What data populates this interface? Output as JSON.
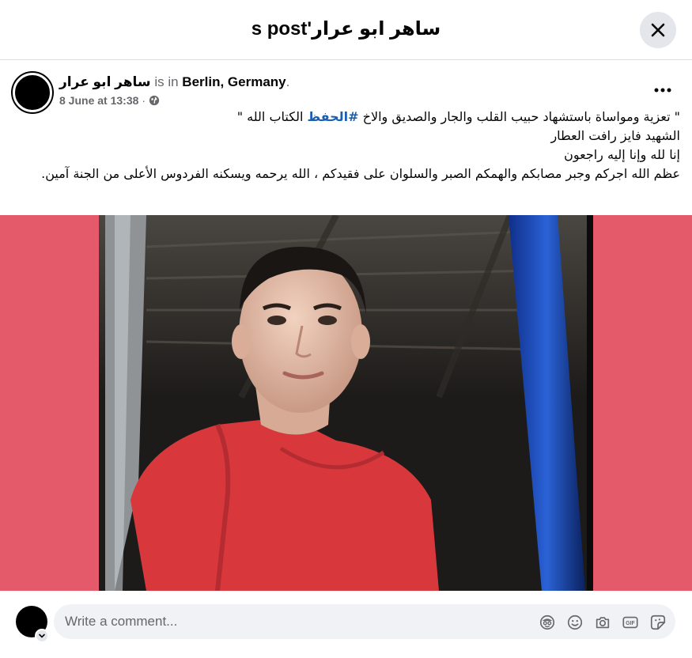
{
  "dialog": {
    "title": "ساهر ابو عرار's post",
    "close_icon": "close-icon"
  },
  "post": {
    "author": "ساهر ابو عرار",
    "is_in": "is in",
    "location": "Berlin, Germany",
    "location_suffix": ".",
    "timestamp": "8 June at 13:38",
    "separator": "·",
    "audience_icon": "globe-icon",
    "more_icon": "more-horizontal-icon",
    "text": {
      "line1_before": "\" تعزية ومواساة باستشهاد حبيب القلب والجار والصديق والاخ ",
      "hashtag": "#الحفظ",
      "line1_after": " الكتاب الله  \"",
      "line2": "الشهيد فايز رافت العطار",
      "line3": "إنا لله وإنا إليه راجعون",
      "line4": "عظم الله اجركم وجبر مصابكم والهمكم الصبر والسلوان على فقيدكم ، الله يرحمه ويسكنه الفردوس الأعلى من الجنة آمين."
    },
    "photo_background": "#e55a6b"
  },
  "composer": {
    "placeholder": "Write a comment...",
    "icons": [
      "avatar-sticker-icon",
      "emoji-icon",
      "camera-icon",
      "gif-icon",
      "sticker-icon"
    ]
  }
}
